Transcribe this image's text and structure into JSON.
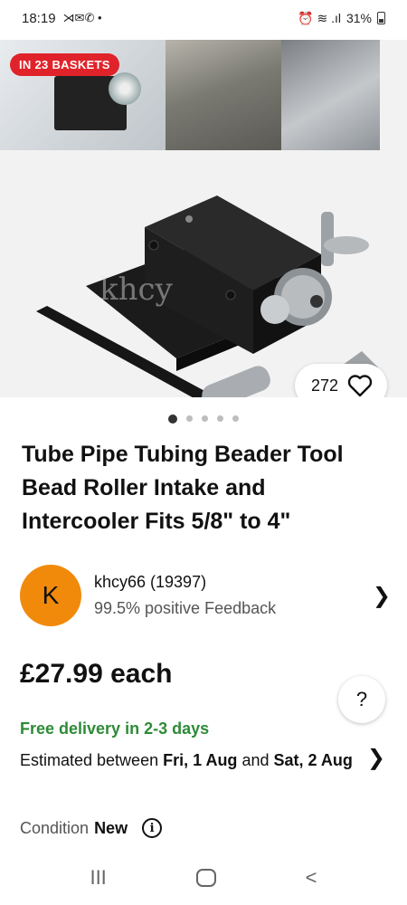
{
  "status_bar": {
    "time": "18:19",
    "notification_icons": "⋊✉✆ •",
    "right_icons": "⏰ ≋ .ıl",
    "battery": "31%"
  },
  "gallery": {
    "badge": "IN 23 BASKETS",
    "like_count": "272",
    "dots_total": 5,
    "dots_active": 0
  },
  "product": {
    "title": "Tube Pipe Tubing Beader Tool Bead Roller Intake and Intercooler Fits 5/8\" to 4\""
  },
  "seller": {
    "avatar_letter": "K",
    "name": "khcy66 (19397)",
    "feedback": "99.5% positive Feedback"
  },
  "price": {
    "label": "£27.99 each"
  },
  "delivery": {
    "headline": "Free delivery in 2-3 days",
    "estimate_prefix": "Estimated between ",
    "date_from": "Fri, 1 Aug",
    "estimate_mid": " and ",
    "date_to": "Sat, 2 Aug"
  },
  "condition": {
    "label": "Condition",
    "value": "New"
  },
  "help": {
    "symbol": "?"
  },
  "navbar": {
    "recent": "III",
    "back": "<"
  },
  "colors": {
    "badge": "#e0232a",
    "avatar": "#f18a0b",
    "delivery": "#2e8b37"
  }
}
